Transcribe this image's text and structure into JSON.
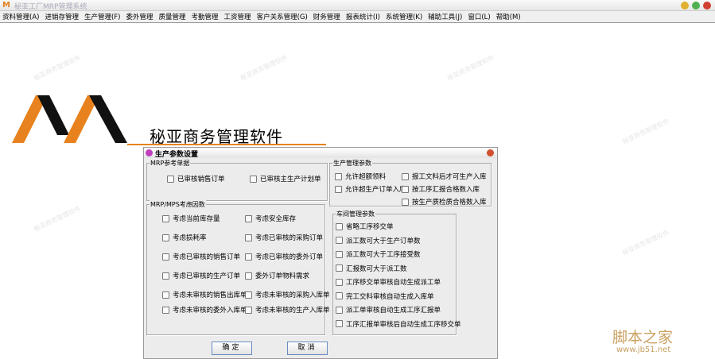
{
  "window": {
    "title": "秘亚工厂MRP管理系统"
  },
  "menu": [
    "资料管理(A)",
    "进销存管理",
    "生产管理(F)",
    "委外管理",
    "质量管理",
    "考勤管理",
    "工资管理",
    "客户关系管理(G)",
    "财务管理",
    "报表统计(I)",
    "系统管理(K)",
    "辅助工具(J)",
    "窗口(L)",
    "帮助(M)"
  ],
  "logo": {
    "text": "秘亚商务管理软件"
  },
  "watermark": {
    "cn": "脚本之家",
    "url": "www.jb51.net"
  },
  "dialog": {
    "title": "生产参数设置",
    "mrp_ref": {
      "label": "MRP参考单据",
      "items": [
        "已审核销售订单",
        "已审核主生产计划单"
      ]
    },
    "mrp_factors": {
      "label": "MRP/MPS考虑因数",
      "items": [
        "考虑当前库存量",
        "考虑安全库存",
        "考虑损耗率",
        "考虑已审核的采购订单",
        "考虑已审核的销售订单",
        "考虑已审核的委外订单",
        "考虑已审核的生产订单",
        "委外订单物料需求",
        "考虑未审核的销售出库单",
        "考虑未审核的采购入库单",
        "考虑未审核的委外入库单",
        "考虑未审核的生产入库单"
      ]
    },
    "prod_mgmt": {
      "label": "生产管理参数",
      "items": [
        "允许超额领料",
        "报工文料后才可生产入库",
        "允许超生产订单入库",
        "按工序汇报合格数入库",
        "按生产质检质合格数入库"
      ]
    },
    "workshop": {
      "label": "车间管理参数",
      "items": [
        "省略工序移交单",
        "派工数可大于生产订单数",
        "派工数可大于工序接受数",
        "汇报数可大于派工数",
        "工序移交单审核自动生成派工单",
        "完工交料审核自动生成入库单",
        "派工单审核自动生成工序汇报单",
        "工序汇报单审核后自动生成工序移交单"
      ]
    },
    "ok": "确定",
    "cancel": "取消"
  }
}
